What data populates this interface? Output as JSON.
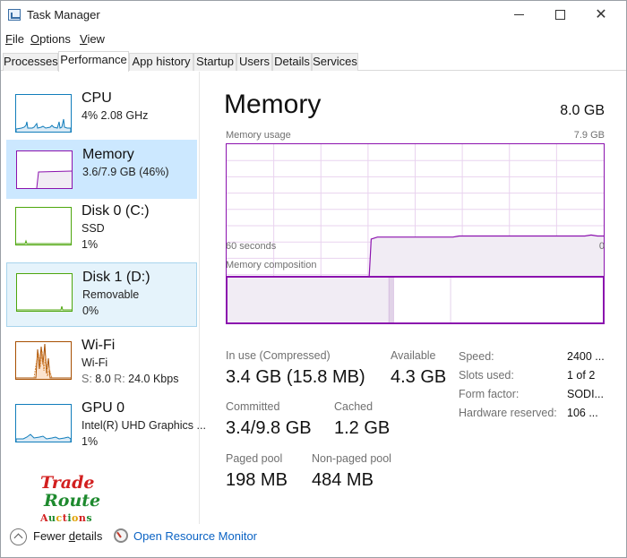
{
  "window": {
    "title": "Task Manager",
    "controls": {
      "minimize": "minimize",
      "maximize": "maximize",
      "close": "✕"
    }
  },
  "menu": [
    {
      "underline": "F",
      "rest": "ile"
    },
    {
      "underline": "O",
      "rest": "ptions"
    },
    {
      "underline": "V",
      "rest": "iew"
    }
  ],
  "tabs": [
    "Processes",
    "Performance",
    "App history",
    "Startup",
    "Users",
    "Details",
    "Services"
  ],
  "active_tab": "Performance",
  "sidebar": {
    "items": [
      {
        "title": "CPU",
        "line1": "4%  2.08 GHz",
        "line2": "",
        "color": "#117dbb",
        "state": "normal"
      },
      {
        "title": "Memory",
        "line1": "3.6/7.9 GB (46%)",
        "line2": "",
        "color": "#8b12ae",
        "state": "selected"
      },
      {
        "title": "Disk 0 (C:)",
        "line1": "SSD",
        "line2": "1%",
        "color": "#4da60c",
        "state": "normal"
      },
      {
        "title": "Disk 1 (D:)",
        "line1": "Removable",
        "line2": "0%",
        "color": "#4da60c",
        "state": "hovered"
      },
      {
        "title": "Wi-Fi",
        "line1": "Wi-Fi",
        "line2_s_label": "S:",
        "line2_s_value": "8.0",
        "line2_r_label": "R:",
        "line2_r_value": "24.0 Kbps",
        "color": "#a74f01",
        "state": "normal"
      },
      {
        "title": "GPU 0",
        "line1": "Intel(R) UHD Graphics ...",
        "line2": "1%",
        "color": "#117dbb",
        "state": "normal"
      }
    ]
  },
  "logo": {
    "trade": "Trade",
    "route": "Route",
    "auctions": [
      {
        "char": "A",
        "color": "#d21f1f"
      },
      {
        "char": "u",
        "color": "#1e8a2e"
      },
      {
        "char": "c",
        "color": "#e0a100"
      },
      {
        "char": "t",
        "color": "#d21f1f"
      },
      {
        "char": "i",
        "color": "#1e8a2e"
      },
      {
        "char": "o",
        "color": "#e0a100"
      },
      {
        "char": "n",
        "color": "#d21f1f"
      },
      {
        "char": "s",
        "color": "#1e8a2e"
      }
    ]
  },
  "footer": {
    "fewer_details_underline": "d",
    "fewer_details_prefix": "Fewer ",
    "fewer_details_suffix": "etails",
    "open_resource_monitor": "Open Resource Monitor"
  },
  "main": {
    "title": "Memory",
    "total": "8.0 GB",
    "usage_chart": {
      "label": "Memory usage",
      "max_label": "7.9 GB",
      "left_time": "60 seconds",
      "right_time": "0",
      "color": "#8b12ae",
      "fill": "#f1ecf4",
      "max_gb": 7.9,
      "seconds": 60,
      "samples_gb": [
        0,
        0,
        0,
        0,
        0,
        0,
        0,
        0,
        0,
        0,
        0,
        0,
        0,
        0,
        0,
        0,
        0,
        0,
        0,
        0,
        0,
        0,
        0,
        3.3,
        3.4,
        3.4,
        3.4,
        3.4,
        3.4,
        3.4,
        3.4,
        3.4,
        3.4,
        3.4,
        3.4,
        3.4,
        3.4,
        3.45,
        3.45,
        3.45,
        3.45,
        3.45,
        3.45,
        3.45,
        3.45,
        3.45,
        3.45,
        3.45,
        3.45,
        3.45,
        3.45,
        3.45,
        3.45,
        3.45,
        3.45,
        3.45,
        3.45,
        3.45,
        3.5,
        3.45,
        3.45
      ],
      "available_from_second": 23
    },
    "composition": {
      "label": "Memory composition",
      "color": "#8b12ae",
      "in_use_gb": 3.4,
      "modified_gb": 0.1,
      "standby_gb": 1.2,
      "free_gb": 3.2
    },
    "stats": {
      "in_use_label": "In use (Compressed)",
      "in_use_value": "3.4 GB (15.8 MB)",
      "available_label": "Available",
      "available_value": "4.3 GB",
      "committed_label": "Committed",
      "committed_value": "3.4/9.8 GB",
      "cached_label": "Cached",
      "cached_value": "1.2 GB",
      "paged_label": "Paged pool",
      "paged_value": "198 MB",
      "nonpaged_label": "Non-paged pool",
      "nonpaged_value": "484 MB"
    },
    "details": [
      {
        "label": "Speed:",
        "value": "2400 ..."
      },
      {
        "label": "Slots used:",
        "value": "1 of 2"
      },
      {
        "label": "Form factor:",
        "value": "SODI..."
      },
      {
        "label": "Hardware reserved:",
        "value": "106 ..."
      }
    ]
  }
}
